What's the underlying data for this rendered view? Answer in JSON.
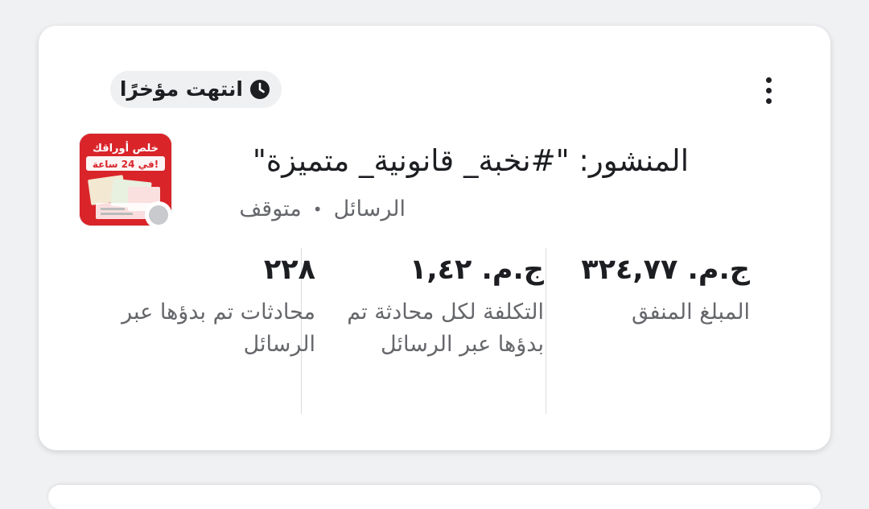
{
  "status": {
    "label": "انتهت مؤخرًا",
    "icon": "clock-icon"
  },
  "menu": {
    "icon": "more-vertical-icon"
  },
  "post": {
    "title": "المنشور: \"#نخبة_ قانونية_ متميزة\"",
    "destination": "الرسائل",
    "separator": "•",
    "state": "متوقف",
    "thumbnail_text": "خلص أوراقك في 24 ساعة!",
    "thumbnail_accent": "#d9252a"
  },
  "metrics": [
    {
      "value": "ج.م. ٣٢٤,٧٧",
      "caption": "المبلغ المنفق"
    },
    {
      "value": "ج.م. ١,٤٢",
      "caption": "التكلفة لكل محادثة تم بدؤها عبر الرسائل"
    },
    {
      "value": "٢٢٨",
      "caption": "محادثات تم بدؤها عبر الرسائل"
    }
  ]
}
